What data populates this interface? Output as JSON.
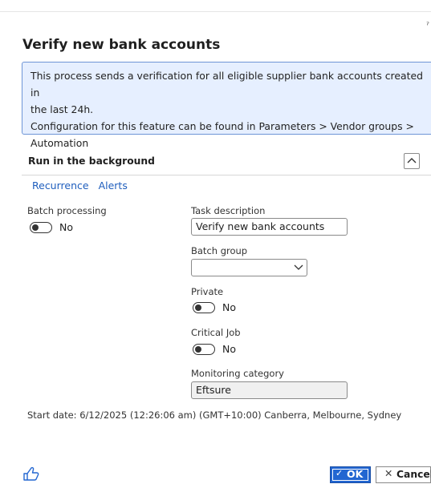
{
  "dialog": {
    "title": "Verify new bank accounts",
    "info_lines": [
      "This process sends a verification for all eligible supplier bank accounts created in",
      "the last 24h.",
      "Configuration for this feature can be found in Parameters > Vendor groups >",
      "Automation"
    ]
  },
  "section": {
    "title": "Run in the background",
    "links": [
      "Recurrence",
      "Alerts"
    ]
  },
  "fields": {
    "batch_processing": {
      "label": "Batch processing",
      "value": "No"
    },
    "task_description": {
      "label": "Task description",
      "value": "Verify new bank accounts"
    },
    "batch_group": {
      "label": "Batch group",
      "value": ""
    },
    "private": {
      "label": "Private",
      "value": "No"
    },
    "critical_job": {
      "label": "Critical Job",
      "value": "No"
    },
    "monitoring_category": {
      "label": "Monitoring category",
      "value": "Eftsure"
    }
  },
  "start_date": "Start date: 6/12/2025 (12:26:06 am) (GMT+10:00) Canberra, Melbourne, Sydney",
  "footer": {
    "ok_label": "OK",
    "cancel_label": "Cancel"
  },
  "colors": {
    "accent": "#2266d1",
    "info_bg": "#e6efff",
    "link": "#1f5ebd"
  }
}
